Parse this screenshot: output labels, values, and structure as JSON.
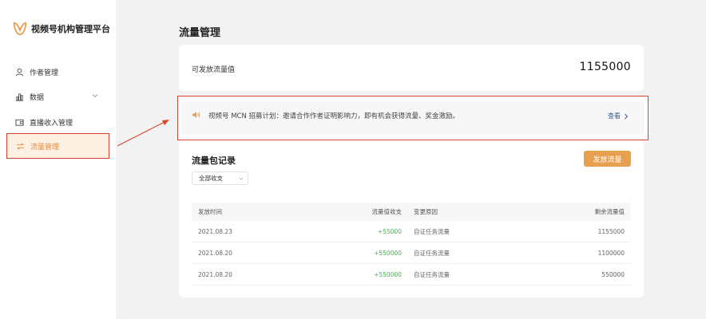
{
  "app": {
    "title": "视频号机构管理平台"
  },
  "sidebar": {
    "items": [
      {
        "label": "作者管理",
        "icon": "user-icon"
      },
      {
        "label": "数据",
        "icon": "bar-chart-icon"
      },
      {
        "label": "直播收入管理",
        "icon": "wallet-icon"
      },
      {
        "label": "流量管理",
        "icon": "transfer-icon",
        "active": true
      }
    ]
  },
  "page": {
    "title": "流量管理"
  },
  "quota": {
    "label": "可发放流量值",
    "value": "1155000"
  },
  "notice": {
    "text": "视频号 MCN 招募计划：邀请合作作者证明影响力，即有机会获得流量、奖金激励。",
    "link": "查看"
  },
  "records": {
    "title": "流量包记录",
    "release_button": "发放流量",
    "filter": "全部收支",
    "columns": [
      "发放时间",
      "流量值收支",
      "变更原因",
      "剩余流量值"
    ],
    "rows": [
      {
        "date": "2021.08.23",
        "change": "+55000",
        "reason": "自证任务流量",
        "remaining": "1155000"
      },
      {
        "date": "2021.08.20",
        "change": "+550000",
        "reason": "自证任务流量",
        "remaining": "1100000"
      },
      {
        "date": "2021.08.20",
        "change": "+550000",
        "reason": "自证任务流量",
        "remaining": "550000"
      }
    ]
  },
  "colors": {
    "accent": "#e8a04e",
    "active_text": "#e8883a",
    "highlight_border": "#d9432f",
    "positive": "#4caf50"
  }
}
